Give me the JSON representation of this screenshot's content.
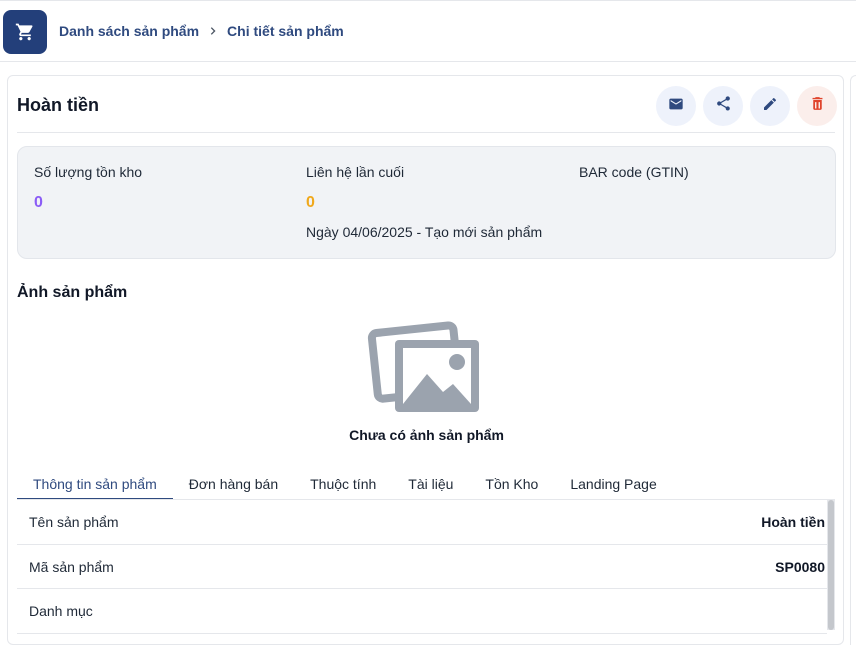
{
  "header": {
    "app_icon": "shopping-cart-icon",
    "breadcrumb": [
      "Danh sách sản phẩm",
      "Chi tiết sản phẩm"
    ]
  },
  "product": {
    "title": "Hoàn tiền",
    "actions": [
      "mail-icon",
      "share-icon",
      "edit-icon",
      "trash-icon"
    ]
  },
  "stats": {
    "stock_label": "Số lượng tồn kho",
    "stock_value": "0",
    "last_contact_label": "Liên hệ lần cuối",
    "last_contact_value": "0",
    "last_contact_note": "Ngày 04/06/2025 - Tạo mới sản phẩm",
    "barcode_label": "BAR code (GTIN)"
  },
  "images": {
    "section_title": "Ảnh sản phẩm",
    "empty_text": "Chưa có ảnh sản phẩm"
  },
  "tabs": [
    "Thông tin sản phẩm",
    "Đơn hàng bán",
    "Thuộc tính",
    "Tài liệu",
    "Tồn Kho",
    "Landing Page"
  ],
  "details": [
    {
      "label": "Tên sản phẩm",
      "value": "Hoàn tiền"
    },
    {
      "label": "Mã sản phẩm",
      "value": "SP0080"
    },
    {
      "label": "Danh mục",
      "value": ""
    }
  ],
  "colors": {
    "primary": "#233f7a",
    "stock_value": "#8b5cf6",
    "contact_value": "#f0a81c",
    "delete": "#e0442c"
  }
}
